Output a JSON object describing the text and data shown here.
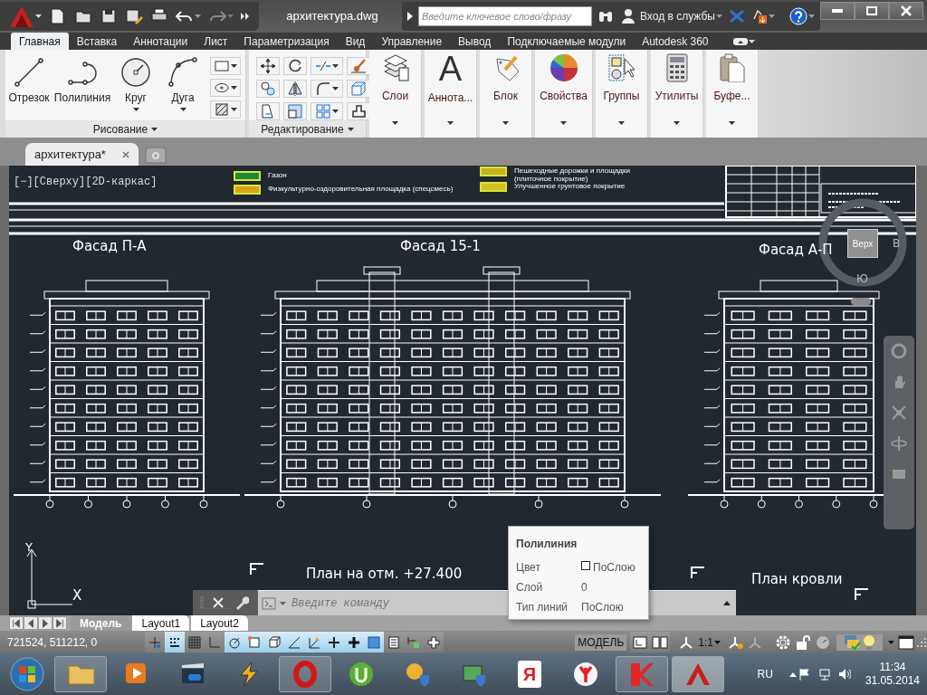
{
  "title_bar": {
    "title": "архитектура.dwg",
    "search_placeholder": "Введите ключевое слово/фразу",
    "sign_in": "Вход в службы"
  },
  "ribbon_tabs": [
    {
      "label": "Главная",
      "selected": true
    },
    {
      "label": "Вставка",
      "selected": false
    },
    {
      "label": "Аннотации",
      "selected": false
    },
    {
      "label": "Лист",
      "selected": false
    },
    {
      "label": "Параметризация",
      "selected": false
    },
    {
      "label": "Вид",
      "selected": false
    },
    {
      "label": "Управление",
      "selected": false
    },
    {
      "label": "Вывод",
      "selected": false
    },
    {
      "label": "Подключаемые модули",
      "selected": false
    },
    {
      "label": "Autodesk 360",
      "selected": false
    }
  ],
  "draw_panel": {
    "title": "Рисование",
    "tools": [
      {
        "label": "Отрезок",
        "kind": "line",
        "dropdown": false
      },
      {
        "label": "Полилиния",
        "kind": "polyline",
        "dropdown": false
      },
      {
        "label": "Круг",
        "kind": "circle",
        "dropdown": true
      },
      {
        "label": "Дуга",
        "kind": "arc",
        "dropdown": true
      }
    ]
  },
  "modify_panel": {
    "title": "Редактирование"
  },
  "large_panels": [
    {
      "label": "Слои",
      "kind": "layers"
    },
    {
      "label": "Аннота...",
      "kind": "annotation",
      "glyph": "A"
    },
    {
      "label": "Блок",
      "kind": "block"
    },
    {
      "label": "Свойства",
      "kind": "properties"
    },
    {
      "label": "Группы",
      "kind": "groups"
    },
    {
      "label": "Утилиты",
      "kind": "utilities"
    },
    {
      "label": "Буфе...",
      "kind": "clipboard"
    }
  ],
  "file_tabs": [
    {
      "label": "архитектура*",
      "selected": true
    }
  ],
  "viewport_label": "[−][Сверху][2D-каркас]",
  "legend": [
    {
      "label": "Газон",
      "kind": "lawn"
    },
    {
      "label": "Физкультурно-оздоровительная площадка (спецсмесь)",
      "kind": "sport"
    },
    {
      "label": "Пешеходные дорожки и площадки (плиточное покрытие)",
      "kind": "paving"
    },
    {
      "label": "Улучшенное грунтовое покрытие",
      "kind": "soil"
    }
  ],
  "facade_titles": [
    "Фасад П-А",
    "Фасад 15-1",
    "Фасад А-П"
  ],
  "plan_titles": [
    "План на отм. +27.400",
    "План кровли"
  ],
  "view_cube": {
    "top": "Верх",
    "east": "В",
    "south": "Ю"
  },
  "ucs": {
    "x_label": "X",
    "y_label": "Y"
  },
  "command_line": {
    "placeholder": "Введите команду"
  },
  "tooltip": {
    "title": "Полилиния",
    "rows": [
      {
        "label": "Цвет",
        "value": "ПоСлою",
        "swatch": true
      },
      {
        "label": "Слой",
        "value": "0",
        "swatch": false
      },
      {
        "label": "Тип линий",
        "value": "ПоСлою",
        "swatch": false
      }
    ]
  },
  "layout_tabs": [
    {
      "label": "Модель",
      "selected": true
    },
    {
      "label": "Layout1",
      "selected": false
    },
    {
      "label": "Layout2",
      "selected": false
    }
  ],
  "status_bar": {
    "coordinates": "721524, 511212, 0",
    "space": "МОДЕЛЬ",
    "scale": "1:1",
    "toggles": [
      {
        "kind": "infer",
        "on": false
      },
      {
        "kind": "snap",
        "on": true
      },
      {
        "kind": "grid",
        "on": false
      },
      {
        "kind": "ortho",
        "on": false
      },
      {
        "kind": "polar",
        "on": true
      },
      {
        "kind": "osnap",
        "on": true
      },
      {
        "kind": "osnap3d",
        "on": true
      },
      {
        "kind": "otrack",
        "on": true
      },
      {
        "kind": "ducs",
        "on": true
      },
      {
        "kind": "dyn",
        "on": true
      },
      {
        "kind": "lwt",
        "on": true
      },
      {
        "kind": "transparency",
        "on": true
      },
      {
        "kind": "qp",
        "on": false
      },
      {
        "kind": "sc",
        "on": false
      },
      {
        "kind": "am",
        "on": false
      }
    ]
  },
  "taskbar": {
    "apps": [
      {
        "kind": "explorer",
        "running": true,
        "selected": false
      },
      {
        "kind": "media",
        "running": false,
        "selected": false
      },
      {
        "kind": "video",
        "running": false,
        "selected": false
      },
      {
        "kind": "winamp",
        "running": false,
        "selected": false
      },
      {
        "kind": "opera",
        "running": true,
        "selected": false
      },
      {
        "kind": "torrent",
        "running": false,
        "selected": false
      },
      {
        "kind": "tools",
        "running": false,
        "selected": false
      },
      {
        "kind": "network",
        "running": false,
        "selected": false
      },
      {
        "kind": "yandex",
        "glyph": "Я",
        "running": false,
        "selected": false
      },
      {
        "kind": "browser",
        "running": false,
        "selected": false
      },
      {
        "kind": "antivirus",
        "running": true,
        "selected": false
      },
      {
        "kind": "autocad",
        "running": true,
        "selected": true
      }
    ],
    "language": "RU",
    "time": "11:34",
    "date": "31.05.2014"
  }
}
